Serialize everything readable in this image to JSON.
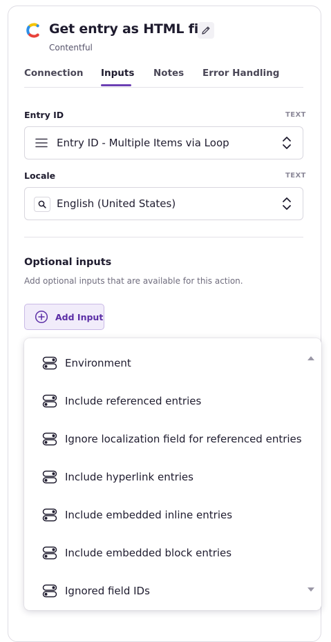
{
  "header": {
    "title": "Get entry as HTML file",
    "subtitle": "Contentful",
    "logo_icon": "contentful-logo-icon",
    "edit_icon": "pencil-icon"
  },
  "tabs": [
    {
      "label": "Connection",
      "active": false
    },
    {
      "label": "Inputs",
      "active": true
    },
    {
      "label": "Notes",
      "active": false
    },
    {
      "label": "Error Handling",
      "active": false
    }
  ],
  "fields": {
    "entry_id": {
      "label": "Entry ID",
      "type": "TEXT",
      "value": "Entry ID - Multiple Items via Loop",
      "icon": "list-icon"
    },
    "locale": {
      "label": "Locale",
      "type": "TEXT",
      "value": "English (United States)",
      "icon": "search-icon"
    }
  },
  "optional_inputs": {
    "title": "Optional inputs",
    "description": "Add optional inputs that are available for this action.",
    "add_button_label": "Add Input"
  },
  "dropdown": {
    "items": [
      "Environment",
      "Include referenced entries",
      "Ignore localization field for referenced entries",
      "Include hyperlink entries",
      "Include embedded inline entries",
      "Include embedded block entries",
      "Ignored field IDs"
    ],
    "item_icon": "toggle-icon"
  },
  "colors": {
    "accent": "#6b3fb3",
    "button_bg": "#f1ecfa",
    "button_text": "#5b2ea6",
    "logo_yellow": "#f5c400",
    "logo_blue": "#2d8fe8",
    "logo_red": "#e8423a"
  }
}
